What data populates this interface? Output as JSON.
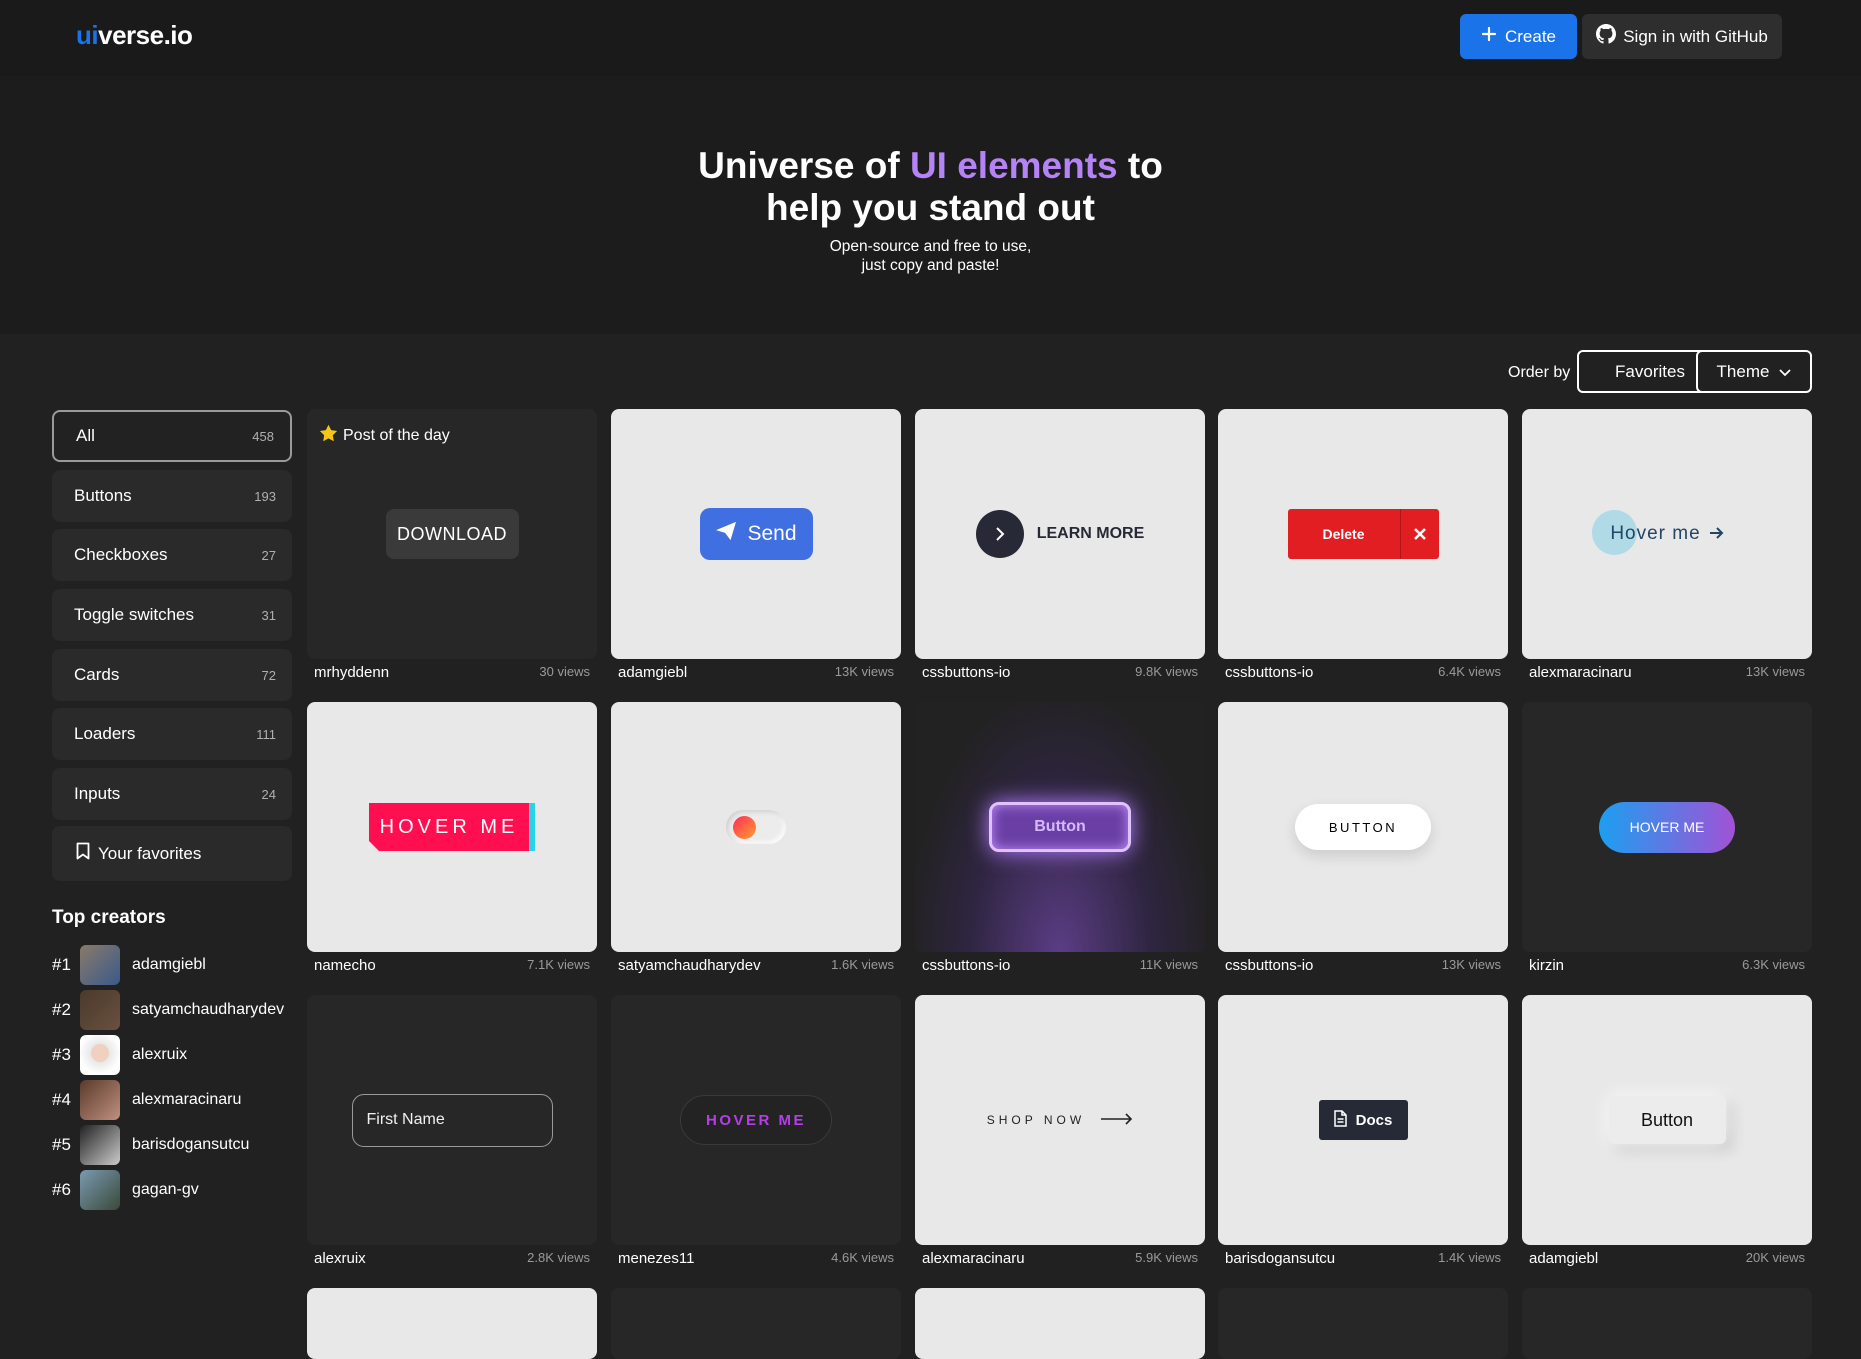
{
  "header": {
    "logo_prefix": "ui",
    "logo_suffix": "verse.io",
    "create_label": "Create",
    "github_label": "Sign in with GitHub"
  },
  "hero": {
    "title_a": "Universe of ",
    "title_highlight": "UI elements",
    "title_b": " to",
    "title_line2": "help you stand out",
    "subtitle_1": "Open-source and free to use,",
    "subtitle_2": "just copy and paste!"
  },
  "toolbar": {
    "order_by": "Order by",
    "favorites": "Favorites",
    "theme": "Theme"
  },
  "sidebar": {
    "items": [
      {
        "label": "All",
        "count": "458"
      },
      {
        "label": "Buttons",
        "count": "193"
      },
      {
        "label": "Checkboxes",
        "count": "27"
      },
      {
        "label": "Toggle switches",
        "count": "31"
      },
      {
        "label": "Cards",
        "count": "72"
      },
      {
        "label": "Loaders",
        "count": "111"
      },
      {
        "label": "Inputs",
        "count": "24"
      }
    ],
    "favorites": "Your favorites",
    "top_creators_title": "Top creators",
    "creators": [
      {
        "rank": "#1",
        "name": "adamgiebl"
      },
      {
        "rank": "#2",
        "name": "satyamchaudharydev"
      },
      {
        "rank": "#3",
        "name": "alexruix"
      },
      {
        "rank": "#4",
        "name": "alexmaracinaru"
      },
      {
        "rank": "#5",
        "name": "barisdogansutcu"
      },
      {
        "rank": "#6",
        "name": "gagan-gv"
      }
    ]
  },
  "cards": [
    {
      "author": "mrhyddenn",
      "views": "30 views",
      "badge": "Post of the day",
      "label": "DOWNLOAD"
    },
    {
      "author": "adamgiebl",
      "views": "13K views",
      "label": "Send"
    },
    {
      "author": "cssbuttons-io",
      "views": "9.8K views",
      "label": "LEARN MORE"
    },
    {
      "author": "cssbuttons-io",
      "views": "6.4K views",
      "label": "Delete"
    },
    {
      "author": "alexmaracinaru",
      "views": "13K views",
      "label": "Hover me"
    },
    {
      "author": "namecho",
      "views": "7.1K views",
      "label": "HOVER ME"
    },
    {
      "author": "satyamchaudharydev",
      "views": "1.6K views"
    },
    {
      "author": "cssbuttons-io",
      "views": "11K views",
      "label": "Button"
    },
    {
      "author": "cssbuttons-io",
      "views": "13K views",
      "label": "BUTTON"
    },
    {
      "author": "kirzin",
      "views": "6.3K views",
      "label": "HOVER ME"
    },
    {
      "author": "alexruix",
      "views": "2.8K views",
      "label": "First Name"
    },
    {
      "author": "menezes11",
      "views": "4.6K views",
      "label": "HOVER ME"
    },
    {
      "author": "alexmaracinaru",
      "views": "5.9K views",
      "label": "SHOP NOW"
    },
    {
      "author": "barisdogansutcu",
      "views": "1.4K views",
      "label": "Docs"
    },
    {
      "author": "adamgiebl",
      "views": "20K views",
      "label": "Button"
    }
  ]
}
